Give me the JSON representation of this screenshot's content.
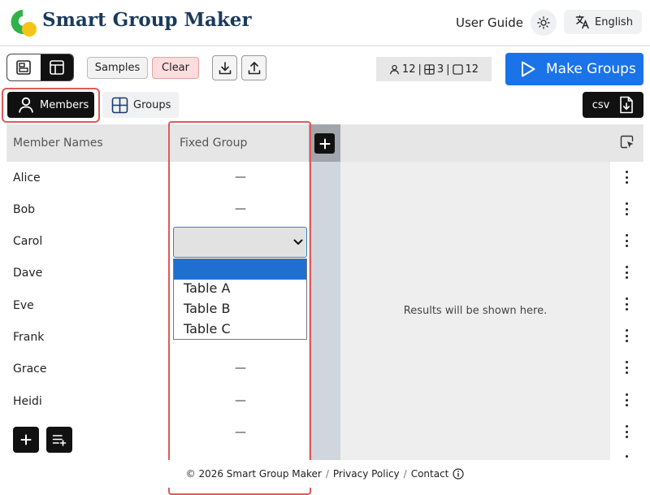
{
  "header": {
    "title": "Smart Group Maker",
    "user_guide": "User Guide",
    "language": "English"
  },
  "toolbar": {
    "samples_label": "Samples",
    "clear_label": "Clear",
    "stats": {
      "members": "12",
      "groups": "3",
      "seats": "12",
      "sep": "|"
    },
    "make_groups_label": "Make Groups"
  },
  "tabs": {
    "members_label": "Members",
    "groups_label": "Groups",
    "csv_label": "csv"
  },
  "table": {
    "col_member_names": "Member Names",
    "col_fixed_group": "Fixed Group",
    "dash": "—",
    "members": [
      "Alice",
      "Bob",
      "Carol",
      "Dave",
      "Eve",
      "Frank",
      "Grace",
      "Heidi"
    ]
  },
  "select": {
    "options": [
      "",
      "Table A",
      "Table B",
      "Table C"
    ]
  },
  "results": {
    "placeholder": "Results will be shown here."
  },
  "footer": {
    "copyright": "© 2026 Smart Group Maker",
    "sep": "/",
    "privacy": "Privacy Policy",
    "contact": "Contact"
  },
  "colors": {
    "primary": "#1a73e8",
    "highlight": "#e05a5a",
    "clear_bg": "#fcdcdc"
  }
}
